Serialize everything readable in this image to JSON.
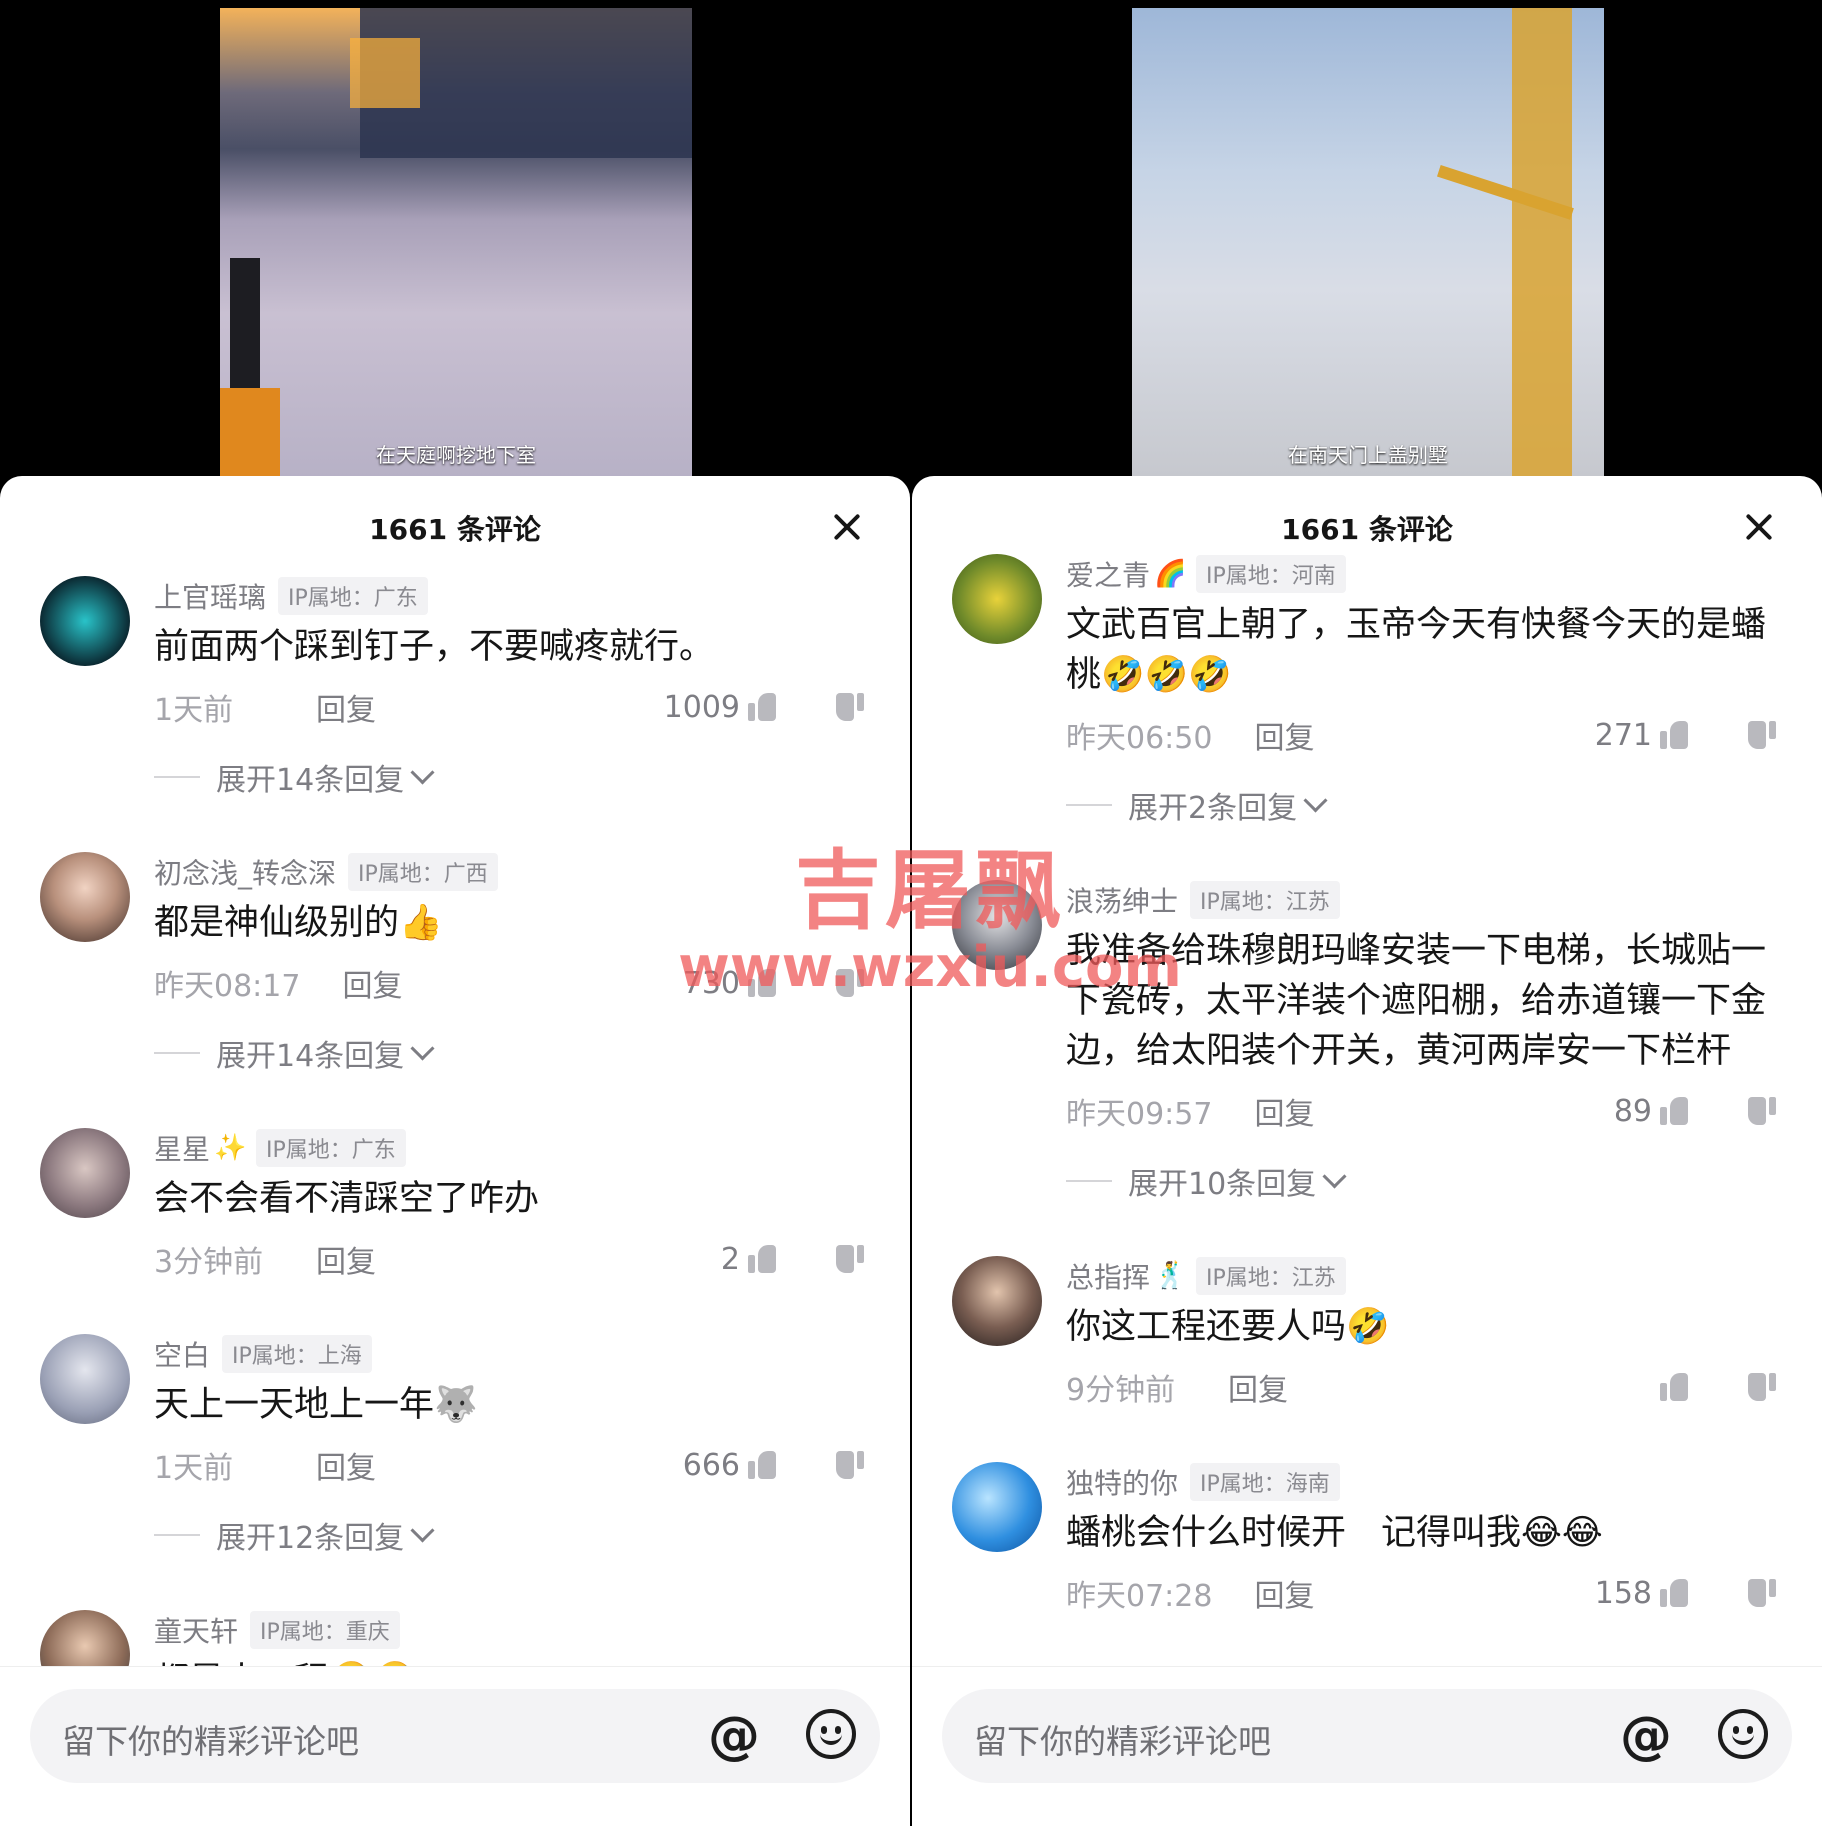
{
  "left": {
    "video": {
      "caption": "在天庭啊挖地下室"
    },
    "sheet": {
      "title": "1661 条评论",
      "comments": [
        {
          "user": "上官瑶璃",
          "emoji": "",
          "ip": "IP属地：广东",
          "text": "前面两个踩到钉子，不要喊疼就行。",
          "time": "1天前",
          "reply": "回复",
          "likes": "1009",
          "expand": "展开14条回复",
          "avatar_color": "#0f3b4a"
        },
        {
          "user": "初念浅_转念深",
          "emoji": "",
          "ip": "IP属地：广西",
          "text": "都是神仙级别的👍",
          "time": "昨天08:17",
          "reply": "回复",
          "likes": "730",
          "expand": "展开14条回复",
          "avatar_color": "#c79b86"
        },
        {
          "user": "星星",
          "emoji": "✨",
          "ip": "IP属地：广东",
          "text": "会不会看不清踩空了咋办",
          "time": "3分钟前",
          "reply": "回复",
          "likes": "2",
          "expand": "",
          "avatar_color": "#8a7c82"
        },
        {
          "user": "空白",
          "emoji": "",
          "ip": "IP属地：上海",
          "text": "天上一天地上一年🐺",
          "time": "1天前",
          "reply": "回复",
          "likes": "666",
          "expand": "展开12条回复",
          "avatar_color": "#9aa0b5"
        },
        {
          "user": "童天轩",
          "emoji": "",
          "ip": "IP属地：重庆",
          "text": "都是大工程🤣🤣",
          "time": "",
          "reply": "",
          "likes": "",
          "expand": "",
          "avatar_color": "#2c2f33"
        }
      ]
    },
    "input": {
      "placeholder": "留下你的精彩评论吧",
      "at": "@"
    }
  },
  "right": {
    "video": {
      "caption": "在南天门上盖别墅"
    },
    "sheet": {
      "title": "1661 条评论",
      "comments": [
        {
          "user": "爱之青",
          "emoji": "🌈",
          "ip": "IP属地：河南",
          "text": "文武百官上朝了，玉帝今天有快餐今天的是蟠桃🤣🤣🤣",
          "time": "昨天06:50",
          "reply": "回复",
          "likes": "271",
          "expand": "展开2条回复",
          "avatar_color": "#6f8a2a"
        },
        {
          "user": "浪荡绅士",
          "emoji": "",
          "ip": "IP属地：江苏",
          "text": "我准备给珠穆朗玛峰安装一下电梯，长城贴一下瓷砖，太平洋装个遮阳棚，给赤道镶一下金边，给太阳装个开关，黄河两岸安一下栏杆",
          "time": "昨天09:57",
          "reply": "回复",
          "likes": "89",
          "expand": "展开10条回复",
          "avatar_color": "#5a5d66"
        },
        {
          "user": "总指挥",
          "emoji": "🕺",
          "ip": "IP属地：江苏",
          "text": "你这工程还要人吗🤣",
          "time": "9分钟前",
          "reply": "回复",
          "likes": "",
          "expand": "",
          "avatar_color": "#3a3030"
        },
        {
          "user": "独特的你",
          "emoji": "",
          "ip": "IP属地：海南",
          "text": "蟠桃会什么时候开　记得叫我😂😂",
          "time": "昨天07:28",
          "reply": "回复",
          "likes": "158",
          "expand": "",
          "avatar_color": "#1e7fd6"
        }
      ]
    },
    "input": {
      "placeholder": "留下你的精彩评论吧",
      "at": "@"
    }
  },
  "watermark": {
    "line1": "吉屠飘",
    "line2": "www.wzxiu.com"
  }
}
